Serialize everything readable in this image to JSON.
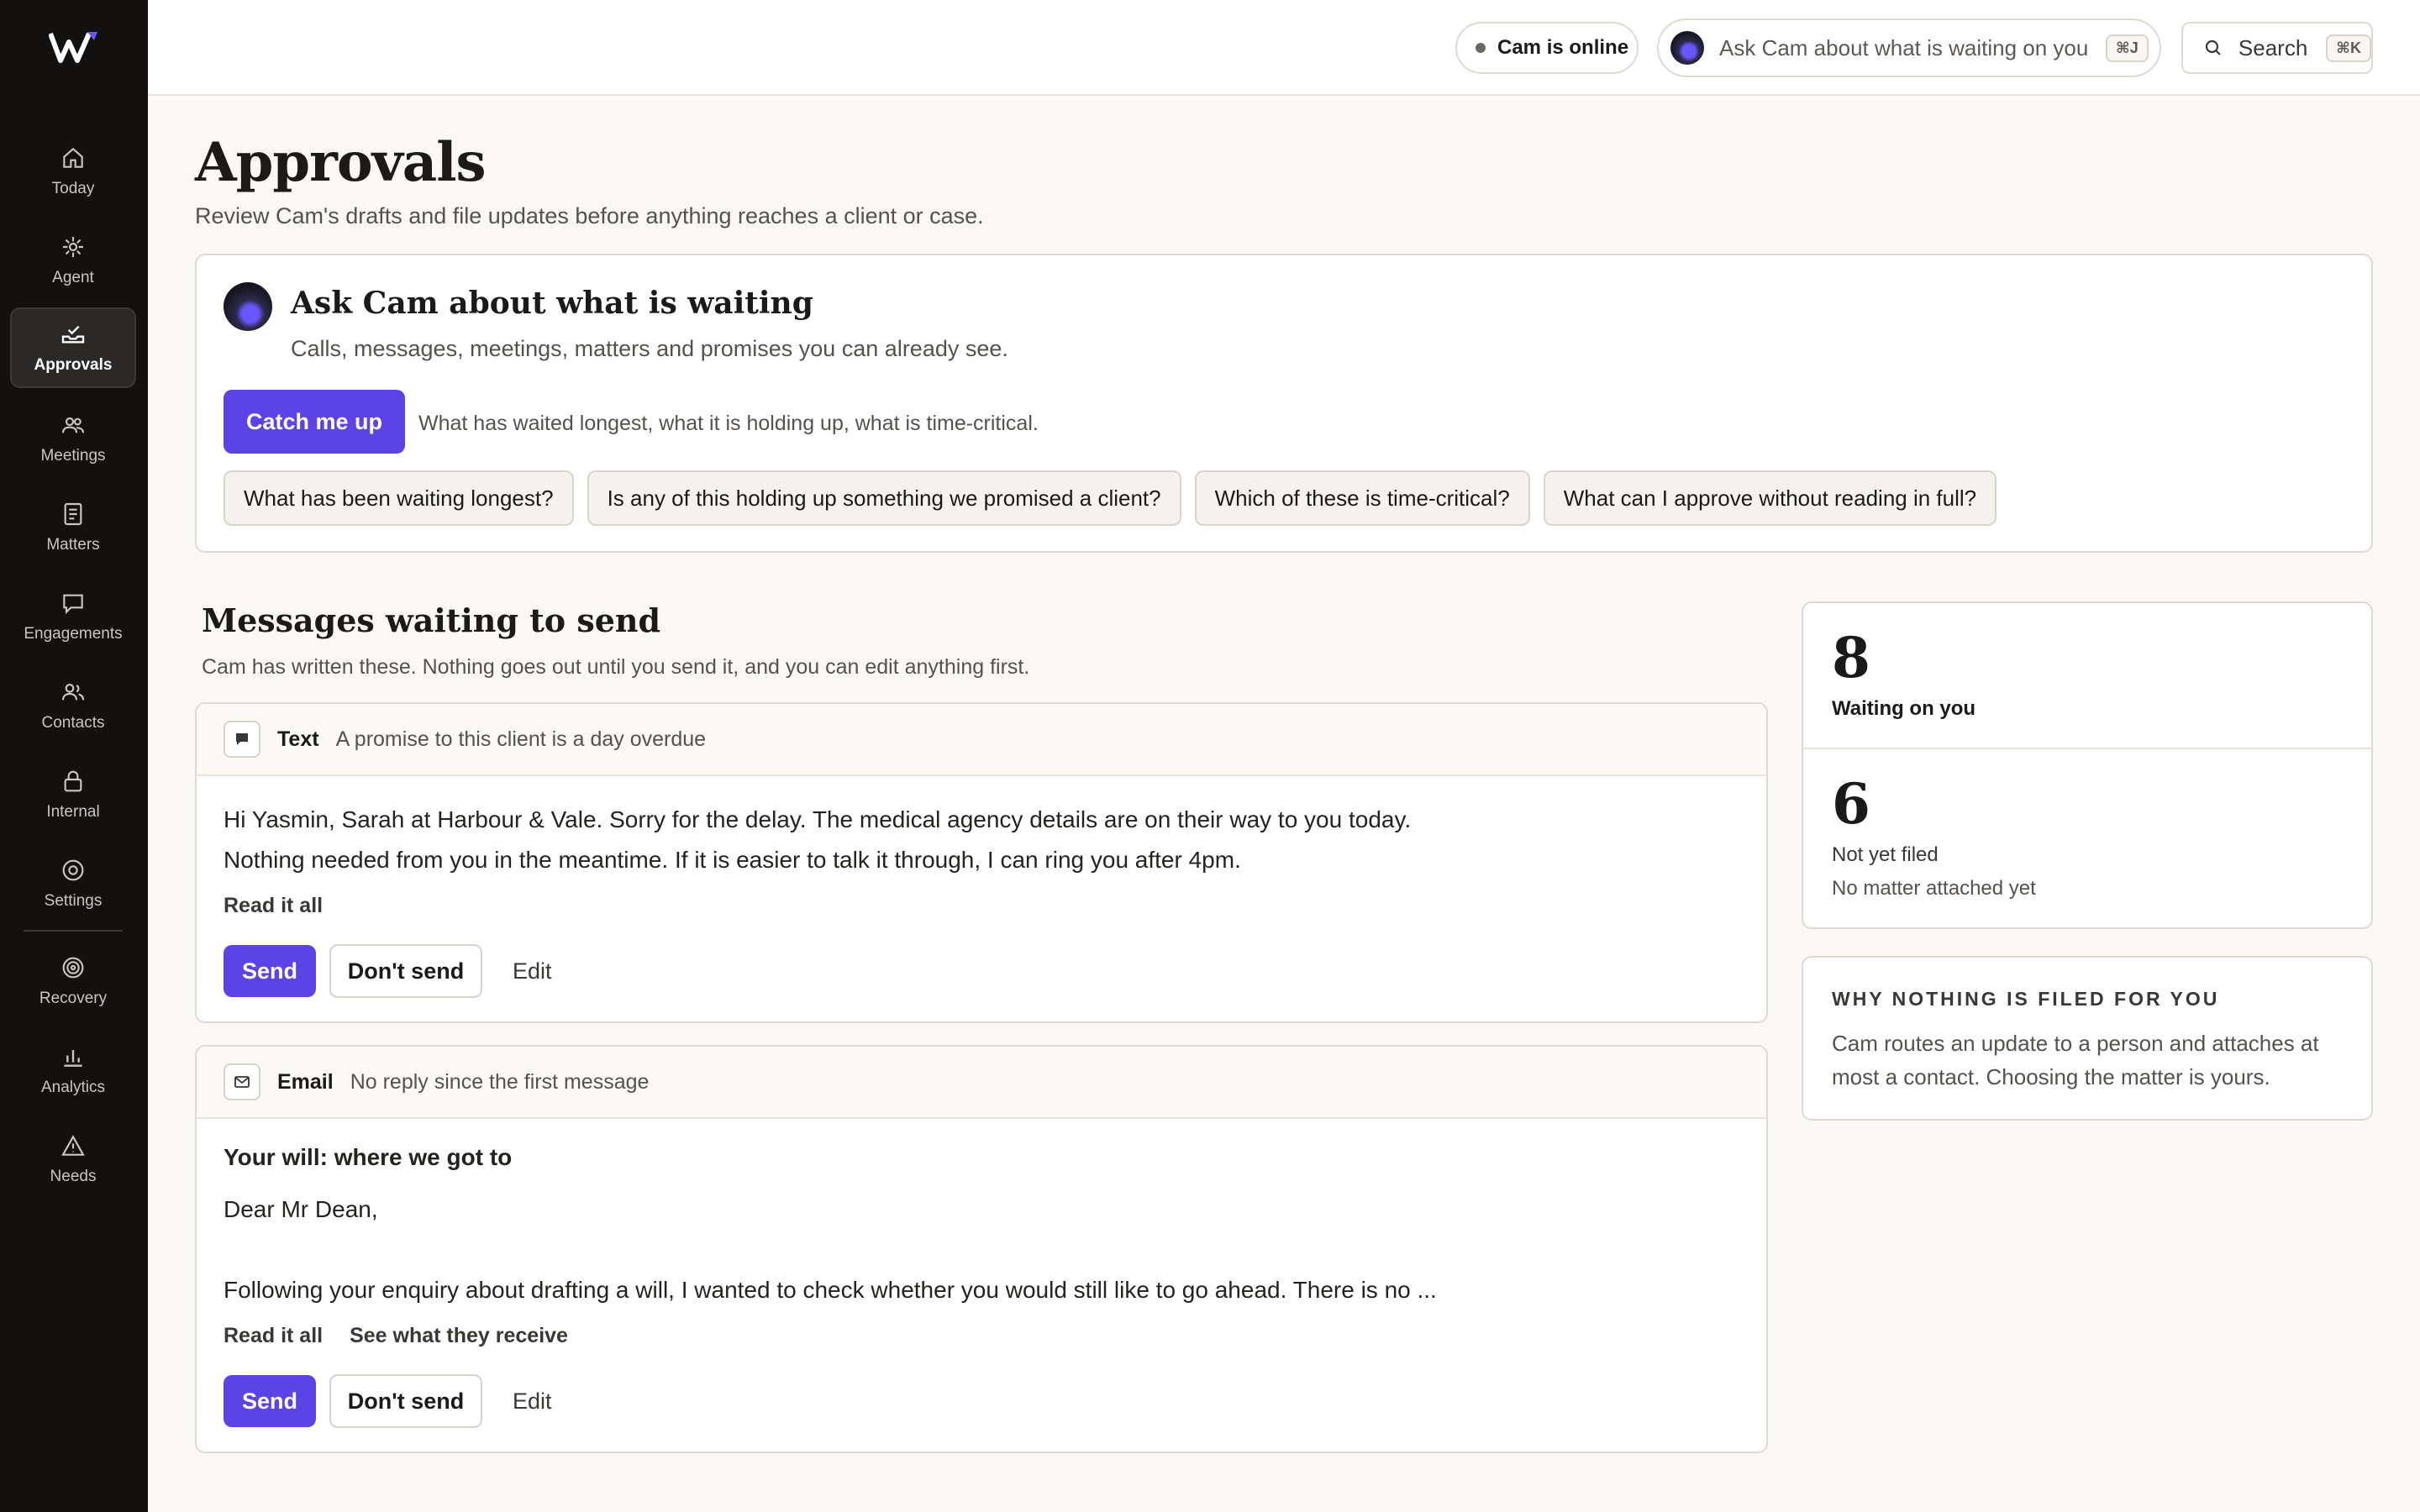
{
  "sidebar": {
    "items": [
      {
        "label": "Today",
        "icon": "home-icon"
      },
      {
        "label": "Agent",
        "icon": "sparkle-icon"
      },
      {
        "label": "Approvals",
        "icon": "inbox-check-icon",
        "active": true
      },
      {
        "label": "Meetings",
        "icon": "people-icon"
      },
      {
        "label": "Matters",
        "icon": "document-icon"
      },
      {
        "label": "Engagements",
        "icon": "chat-bubble-icon"
      },
      {
        "label": "Contacts",
        "icon": "contacts-icon"
      },
      {
        "label": "Internal",
        "icon": "lock-icon"
      },
      {
        "label": "Settings",
        "icon": "gear-icon"
      },
      {
        "label": "Recovery",
        "icon": "target-icon"
      },
      {
        "label": "Analytics",
        "icon": "bar-chart-icon"
      },
      {
        "label": "Needs",
        "icon": "warning-icon"
      }
    ]
  },
  "topbar": {
    "status": "Cam is online",
    "ask_placeholder": "Ask Cam about what is waiting on you",
    "ask_shortcut": "⌘J",
    "search_label": "Search",
    "search_shortcut": "⌘K"
  },
  "page": {
    "title": "Approvals",
    "subtitle": "Review Cam's drafts and file updates before anything reaches a client or case."
  },
  "ask_card": {
    "title": "Ask Cam about what is waiting",
    "description": "Calls, messages, meetings, matters and promises you can already see.",
    "catch_up_label": "Catch me up",
    "catch_up_hint": "What has waited longest, what it is holding up, what is time-critical.",
    "chips": [
      "What has been waiting longest?",
      "Is any of this holding up something we promised a client?",
      "Which of these is time-critical?",
      "What can I approve without reading in full?"
    ]
  },
  "messages": {
    "title": "Messages waiting to send",
    "subtitle": "Cam has written these. Nothing goes out until you send it, and you can edit anything first.",
    "items": [
      {
        "type": "Text",
        "reason": "A promise to this client is a day overdue",
        "lines": [
          "Hi Yasmin, Sarah at Harbour & Vale. Sorry for the delay. The medical agency details are on their way to you today.",
          "Nothing needed from you in the meantime. If it is easier to talk it through, I can ring you after 4pm."
        ],
        "read_all": "Read it all",
        "send": "Send",
        "dont_send": "Don't send",
        "edit": "Edit"
      },
      {
        "type": "Email",
        "reason": "No reply since the first message",
        "subject": "Your will: where we got to",
        "greeting": "Dear Mr Dean,",
        "preview": "Following your enquiry about drafting a will, I wanted to check whether you would still like to go ahead. There is no ...",
        "read_all": "Read it all",
        "see_receive": "See what they receive",
        "send": "Send",
        "dont_send": "Don't send",
        "edit": "Edit"
      }
    ]
  },
  "stats": {
    "waiting_count": "8",
    "waiting_label": "Waiting on you",
    "unfiled_count": "6",
    "unfiled_label": "Not yet filed",
    "unfiled_note": "No matter attached yet"
  },
  "why": {
    "title": "WHY NOTHING IS FILED FOR YOU",
    "text": "Cam routes an update to a person and attaches at most a contact. Choosing the matter is yours."
  },
  "colors": {
    "accent": "#5b43e6",
    "sidebar": "#121110",
    "background": "#f9f8f5"
  }
}
